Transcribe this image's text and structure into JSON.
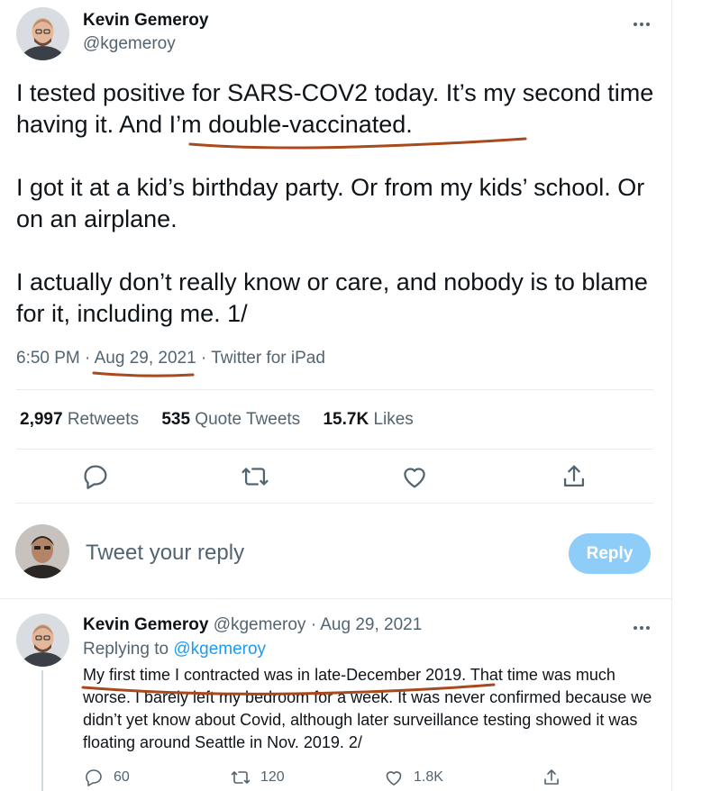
{
  "tweet": {
    "author_name": "Kevin Gemeroy",
    "author_handle": "@kgemeroy",
    "paragraphs": [
      "I tested positive for SARS-COV2 today.  It’s my second time having it.  And I’m double-vaccinated.",
      "I got it at a kid’s birthday party.  Or from my kids’ school.  Or on an airplane.",
      "I actually don’t really know or care, and nobody is to blame for it, including me.  1/"
    ],
    "time": "6:50 PM",
    "date": "Aug 29, 2021",
    "source": "Twitter for iPad",
    "retweets_count": "2,997",
    "retweets_label": "Retweets",
    "quotes_count": "535",
    "quotes_label": "Quote Tweets",
    "likes_count": "15.7K",
    "likes_label": "Likes"
  },
  "compose": {
    "placeholder": "Tweet your reply",
    "button_label": "Reply"
  },
  "reply_tweet": {
    "author_name": "Kevin Gemeroy",
    "author_handle": "@kgemeroy",
    "date": "Aug 29, 2021",
    "replying_label": "Replying to",
    "replying_handle": "@kgemeroy",
    "text": "My first time I contracted was in late-December 2019.  That time was much worse.  I barely left my bedroom for a week.  It was never confirmed because we didn’t yet know about Covid, although later surveillance testing showed it was floating around Seattle in Nov. 2019.  2/",
    "reply_count": "60",
    "retweet_count": "120",
    "like_count": "1.8K"
  },
  "colors": {
    "secondary_text": "#536471",
    "link": "#1d9bf0",
    "reply_button": "#8ecdf8",
    "annotation_underline": "#a84a1e"
  },
  "icons": [
    "more-icon",
    "reply-icon",
    "retweet-icon",
    "like-icon",
    "share-icon"
  ]
}
